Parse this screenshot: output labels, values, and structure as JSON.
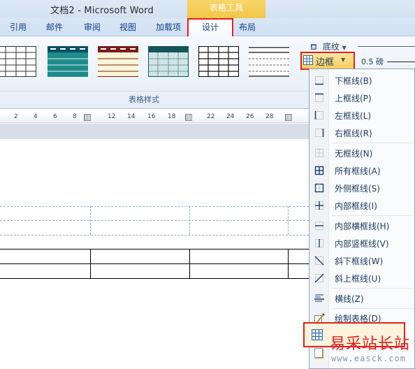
{
  "window": {
    "title": "文档2 - Microsoft Word",
    "context_tab_title": "表格工具"
  },
  "tabs": [
    {
      "label": "引用"
    },
    {
      "label": "邮件"
    },
    {
      "label": "审阅"
    },
    {
      "label": "视图"
    },
    {
      "label": "加载项"
    },
    {
      "label": "设计",
      "active": true
    },
    {
      "label": "布局"
    }
  ],
  "ribbon": {
    "group_label": "表格样式",
    "shading_label": "底纹",
    "border_label": "边框",
    "pen_weight": "0.5 磅"
  },
  "ruler": {
    "numbers": [
      "2",
      "4",
      "6",
      "8",
      "12",
      "14",
      "16",
      "18",
      "22",
      "24",
      "26",
      "28"
    ]
  },
  "menu": {
    "items": [
      {
        "label": "下框线(B)",
        "icon": "bottom-border-icon"
      },
      {
        "label": "上框线(P)",
        "icon": "top-border-icon"
      },
      {
        "label": "左框线(L)",
        "icon": "left-border-icon"
      },
      {
        "label": "右框线(R)",
        "icon": "right-border-icon"
      },
      {
        "label": "无框线(N)",
        "icon": "no-border-icon"
      },
      {
        "label": "所有框线(A)",
        "icon": "all-borders-icon"
      },
      {
        "label": "外侧框线(S)",
        "icon": "outside-borders-icon"
      },
      {
        "label": "内部框线(I)",
        "icon": "inside-borders-icon"
      },
      {
        "label": "内部横框线(H)",
        "icon": "inside-horizontal-border-icon"
      },
      {
        "label": "内部竖框线(V)",
        "icon": "inside-vertical-border-icon"
      },
      {
        "label": "斜下框线(W)",
        "icon": "diagonal-down-border-icon"
      },
      {
        "label": "斜上框线(U)",
        "icon": "diagonal-up-border-icon"
      },
      {
        "label": "横线(Z)",
        "icon": "horizontal-line-icon"
      },
      {
        "label": "绘制表格(D)",
        "icon": "draw-table-icon"
      }
    ]
  },
  "watermark": {
    "text": "易采站长站",
    "url": "www.easck.com"
  },
  "colors": {
    "highlight_red": "#e02020",
    "ribbon_blue": "#d3e1f1",
    "context_yellow": "#f2c64a"
  }
}
